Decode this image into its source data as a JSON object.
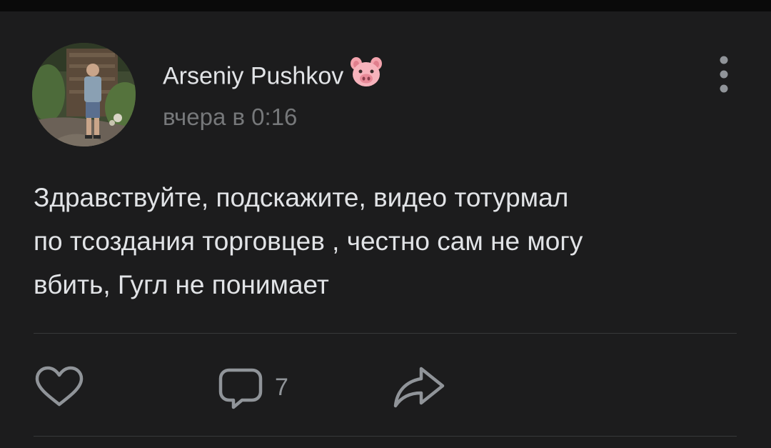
{
  "post": {
    "author": "Arseniy Pushkov",
    "author_badge": "pig-face-icon",
    "time": "вчера в 0:16",
    "text_lines": [
      "Здравствуйте, подскажите, видео тотурмал",
      "по тсоздания торговцев , честно сам не могу",
      "вбить, Гугл не понимает"
    ]
  },
  "actions": {
    "comment_count": "7"
  },
  "colors": {
    "background": "#1c1c1d",
    "text_primary": "#e1e3e6",
    "text_secondary": "#76787a",
    "icon": "#909499"
  }
}
